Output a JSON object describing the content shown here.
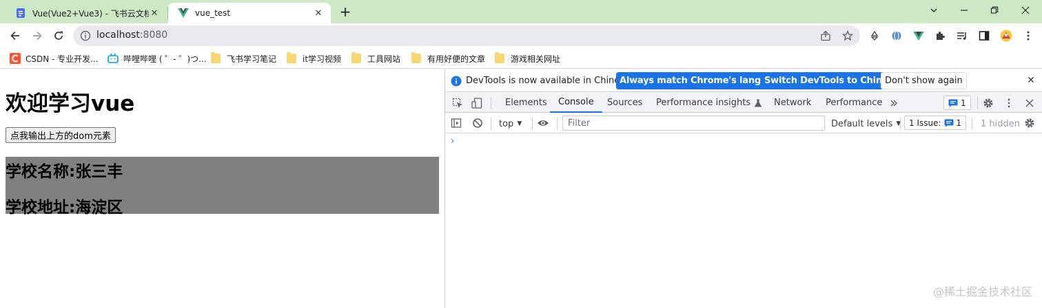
{
  "browser": {
    "tabs": [
      {
        "title": "Vue(Vue2+Vue3) - 飞书云文档",
        "active": false
      },
      {
        "title": "vue_test",
        "active": true
      }
    ],
    "url_host": "localhost",
    "url_port": ":8080"
  },
  "bookmarks": [
    {
      "label": "CSDN - 专业开发..."
    },
    {
      "label": "哔哩哔哩 ( ゜- ゜)つ..."
    },
    {
      "label": "飞书学习笔记"
    },
    {
      "label": "it学习视频"
    },
    {
      "label": "工具网站"
    },
    {
      "label": "有用好便的文章"
    },
    {
      "label": "游戏相关网址"
    }
  ],
  "page": {
    "heading": "欢迎学习vue",
    "button_label": "点我输出上方的dom元素",
    "school_name": "学校名称:张三丰",
    "school_address": "学校地址:海淀区",
    "school_bg": "#808080"
  },
  "devtools": {
    "banner_message": "DevTools is now available in Chinese!",
    "banner_btn_match": "Always match Chrome's language",
    "banner_btn_switch": "Switch DevTools to Chinese",
    "banner_btn_dismiss": "Don't show again",
    "tabs": [
      "Elements",
      "Console",
      "Sources",
      "Performance insights",
      "Network",
      "Performance"
    ],
    "selected_tab": "Console",
    "issues_badge_count": "1",
    "context": "top",
    "filter_placeholder": "Filter",
    "levels": "Default levels",
    "issue_count": "1 Issue:",
    "issue_badge": "1",
    "hidden": "1 hidden",
    "prompt": "›",
    "accent": "#1a73e8"
  },
  "watermark": "@稀土掘金技术社区"
}
